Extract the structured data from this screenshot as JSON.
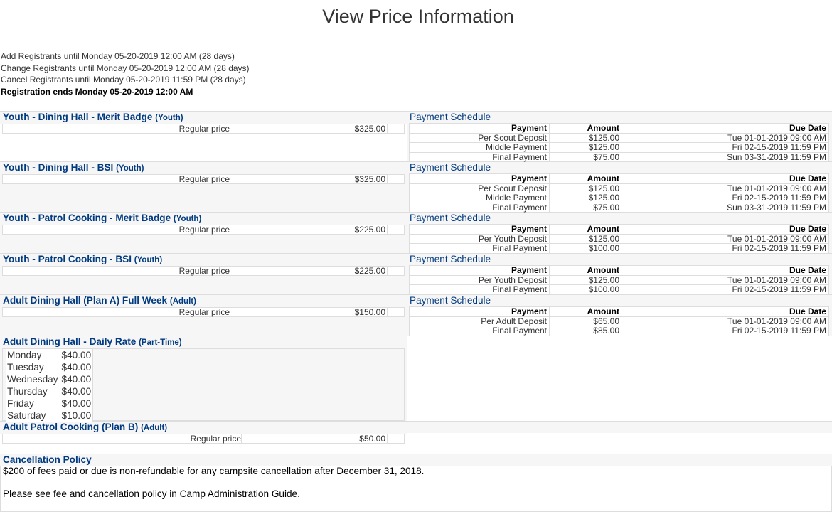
{
  "page_title": "View Price Information",
  "registration": {
    "add": "Add Registrants until Monday 05-20-2019 12:00 AM (28 days)",
    "change": "Change Registrants until Monday 05-20-2019 12:00 AM (28 days)",
    "cancel": "Cancel Registrants until Monday 05-20-2019 11:59 PM (28 days)",
    "ends": "Registration ends Monday 05-20-2019 12:00 AM"
  },
  "schedule_title": "Payment Schedule",
  "schedule_headers": {
    "payment": "Payment",
    "amount": "Amount",
    "due": "Due Date"
  },
  "regular_label": "Regular price",
  "prices": [
    {
      "name": "Youth - Dining Hall - Merit Badge",
      "kind": "(Youth)",
      "price": "$325.00",
      "schedule": [
        {
          "payment": "Per Scout Deposit",
          "amount": "$125.00",
          "due": "Tue 01-01-2019 09:00 AM"
        },
        {
          "payment": "Middle Payment",
          "amount": "$125.00",
          "due": "Fri 02-15-2019 11:59 PM"
        },
        {
          "payment": "Final Payment",
          "amount": "$75.00",
          "due": "Sun 03-31-2019 11:59 PM"
        }
      ]
    },
    {
      "name": "Youth - Dining Hall - BSI",
      "kind": "(Youth)",
      "price": "$325.00",
      "schedule": [
        {
          "payment": "Per Scout Deposit",
          "amount": "$125.00",
          "due": "Tue 01-01-2019 09:00 AM"
        },
        {
          "payment": "Middle Payment",
          "amount": "$125.00",
          "due": "Fri 02-15-2019 11:59 PM"
        },
        {
          "payment": "Final Payment",
          "amount": "$75.00",
          "due": "Sun 03-31-2019 11:59 PM"
        }
      ]
    },
    {
      "name": "Youth - Patrol Cooking - Merit Badge",
      "kind": "(Youth)",
      "price": "$225.00",
      "schedule": [
        {
          "payment": "Per Youth Deposit",
          "amount": "$125.00",
          "due": "Tue 01-01-2019 09:00 AM"
        },
        {
          "payment": "Final Payment",
          "amount": "$100.00",
          "due": "Fri 02-15-2019 11:59 PM"
        }
      ]
    },
    {
      "name": "Youth - Patrol Cooking - BSI",
      "kind": "(Youth)",
      "price": "$225.00",
      "schedule": [
        {
          "payment": "Per Youth Deposit",
          "amount": "$125.00",
          "due": "Tue 01-01-2019 09:00 AM"
        },
        {
          "payment": "Final Payment",
          "amount": "$100.00",
          "due": "Fri 02-15-2019 11:59 PM"
        }
      ]
    },
    {
      "name": "Adult Dining Hall (Plan A) Full Week",
      "kind": "(Adult)",
      "price": "$150.00",
      "schedule": [
        {
          "payment": "Per Adult Deposit",
          "amount": "$65.00",
          "due": "Tue 01-01-2019 09:00 AM"
        },
        {
          "payment": "Final Payment",
          "amount": "$85.00",
          "due": "Fri 02-15-2019 11:59 PM"
        }
      ]
    }
  ],
  "daily": {
    "name": "Adult Dining Hall - Daily Rate",
    "kind": "(Part-Time)",
    "days": [
      {
        "day": "Monday",
        "price": "$40.00"
      },
      {
        "day": "Tuesday",
        "price": "$40.00"
      },
      {
        "day": "Wednesday",
        "price": "$40.00"
      },
      {
        "day": "Thursday",
        "price": "$40.00"
      },
      {
        "day": "Friday",
        "price": "$40.00"
      },
      {
        "day": "Saturday",
        "price": "$10.00"
      }
    ]
  },
  "plan_b": {
    "name": "Adult Patrol Cooking (Plan B)",
    "kind": "(Adult)",
    "price": "$50.00"
  },
  "cancellation": {
    "title": "Cancellation Policy",
    "line1": "$200 of fees paid or due is non-refundable for any campsite cancellation after December 31, 2018.",
    "line2": "Please see fee and cancellation policy in Camp Administration Guide."
  }
}
